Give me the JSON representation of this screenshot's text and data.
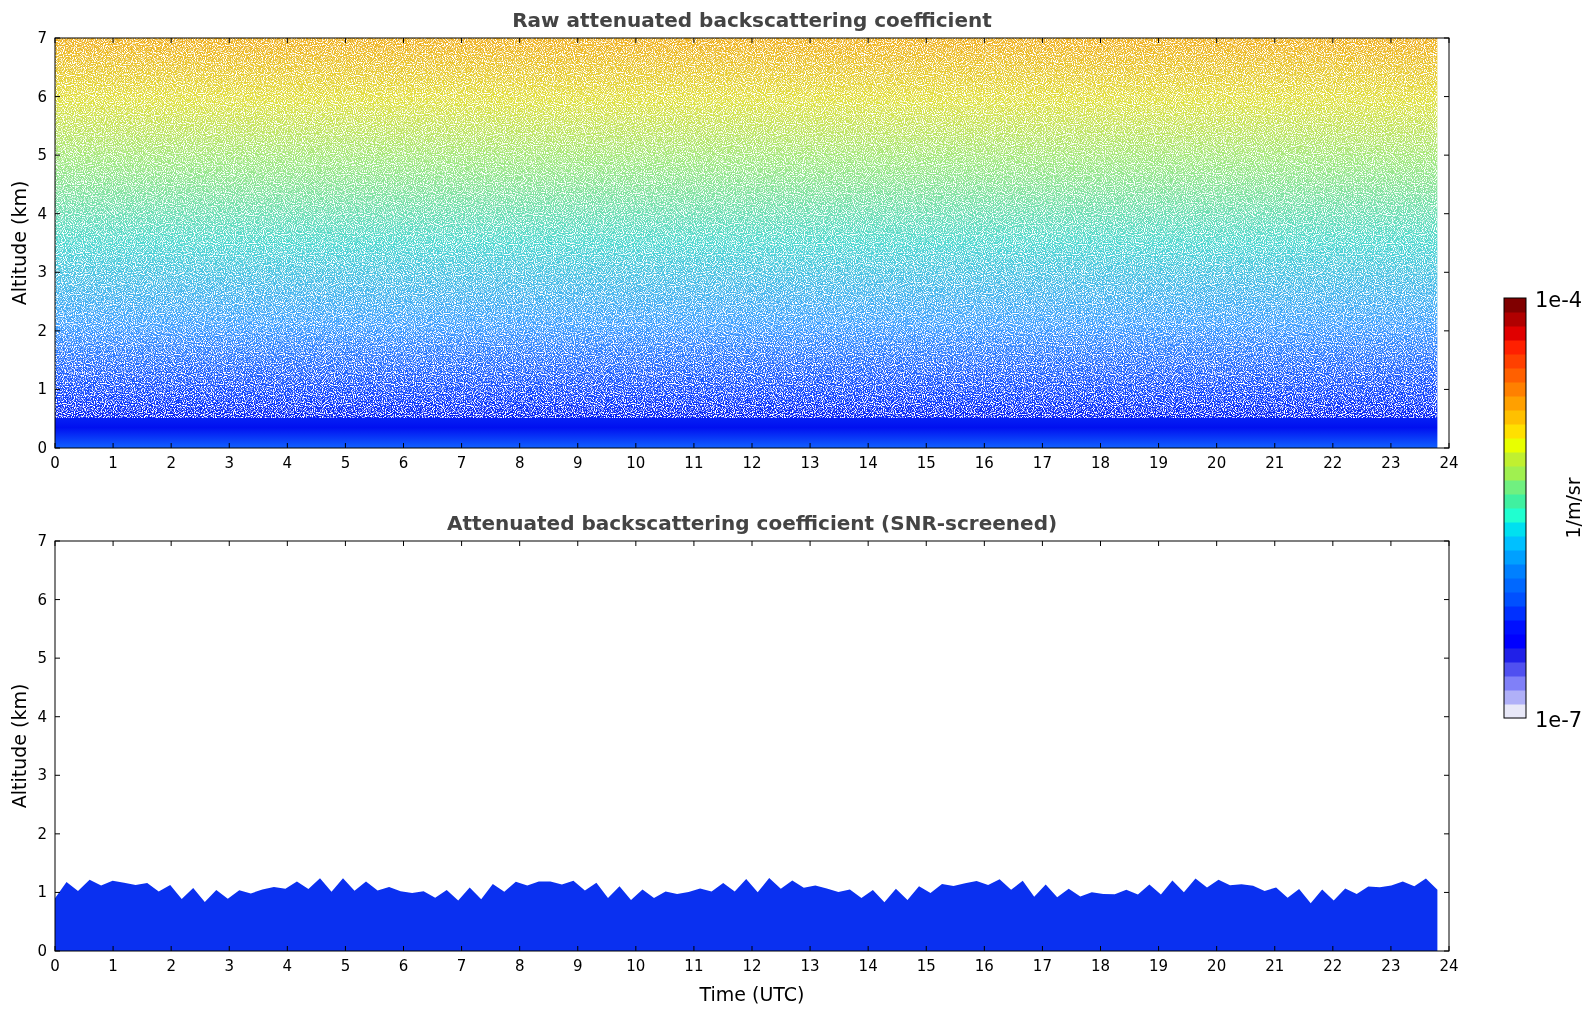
{
  "panels": [
    {
      "kind": "raw",
      "title": "Raw attenuated backscattering coefficient",
      "ylabel": "Altitude (km)",
      "yticks": [
        "7",
        "6",
        "5",
        "4",
        "3",
        "2",
        "1",
        "0"
      ],
      "xticks": [
        "0",
        "1",
        "2",
        "3",
        "4",
        "5",
        "6",
        "7",
        "8",
        "9",
        "10",
        "11",
        "12",
        "13",
        "14",
        "15",
        "16",
        "17",
        "18",
        "19",
        "20",
        "21",
        "22",
        "23",
        "24"
      ]
    },
    {
      "kind": "screened",
      "title": "Attenuated backscattering coefficient (SNR-screened)",
      "ylabel": "Altitude (km)",
      "yticks": [
        "7",
        "6",
        "5",
        "4",
        "3",
        "2",
        "1",
        "0"
      ],
      "xticks": [
        "0",
        "1",
        "2",
        "3",
        "4",
        "5",
        "6",
        "7",
        "8",
        "9",
        "10",
        "11",
        "12",
        "13",
        "14",
        "15",
        "16",
        "17",
        "18",
        "19",
        "20",
        "21",
        "22",
        "23",
        "24"
      ],
      "xlabel": "Time (UTC)"
    }
  ],
  "colorbar": {
    "max_label": "1e-4",
    "min_label": "1e-7",
    "unit": "1/m/sr"
  }
}
